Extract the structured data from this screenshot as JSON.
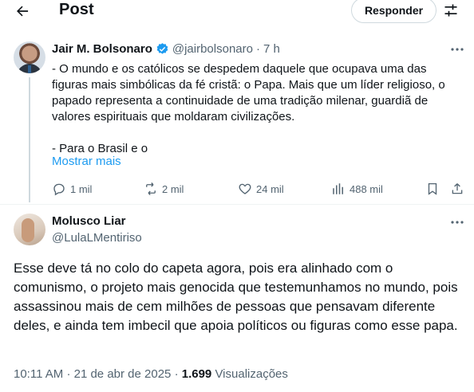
{
  "header": {
    "title": "Post",
    "reply_label": "Responder"
  },
  "parent_tweet": {
    "author_name": "Jair M. Bolsonaro",
    "handle": "@jairbolsonaro",
    "separator": "·",
    "time": "7 h",
    "text": "- O mundo e os católicos se despedem daquele que ocupava uma das figuras mais simbólicas da fé cristã: o Papa. Mais que um líder religioso, o papado representa a continuidade de uma tradição milenar, guardiã de valores espirituais que moldaram civilizações.\n\n- Para o Brasil e o",
    "show_more": "Mostrar mais",
    "stats": {
      "replies": "1 mil",
      "reposts": "2 mil",
      "likes": "24 mil",
      "views": "488 mil"
    }
  },
  "main_tweet": {
    "author_name": "Molusco Liar",
    "handle": "@LulaLMentiriso",
    "text": "Esse deve tá no colo do capeta agora, pois era alinhado com o comunismo, o projeto mais genocida que testemunhamos no mundo, pois assassinou mais de cem milhões de pessoas que pensavam diferente deles, e ainda tem imbecil que apoia políticos ou figuras como esse papa.",
    "time": "10:11 AM",
    "date_sep": "·",
    "date": "21 de abr de 2025",
    "views_sep": "·",
    "views_count": "1.699",
    "views_label": "Visualizações"
  },
  "icons": [
    "back-arrow-icon",
    "filter-icon",
    "verified-badge-icon",
    "more-icon",
    "reply-icon",
    "repost-icon",
    "like-icon",
    "views-icon",
    "bookmark-icon",
    "share-icon"
  ],
  "colors": {
    "link": "#1d9bf0",
    "secondary_text": "#536471",
    "text": "#0f1419",
    "divider": "#eff3f4"
  }
}
